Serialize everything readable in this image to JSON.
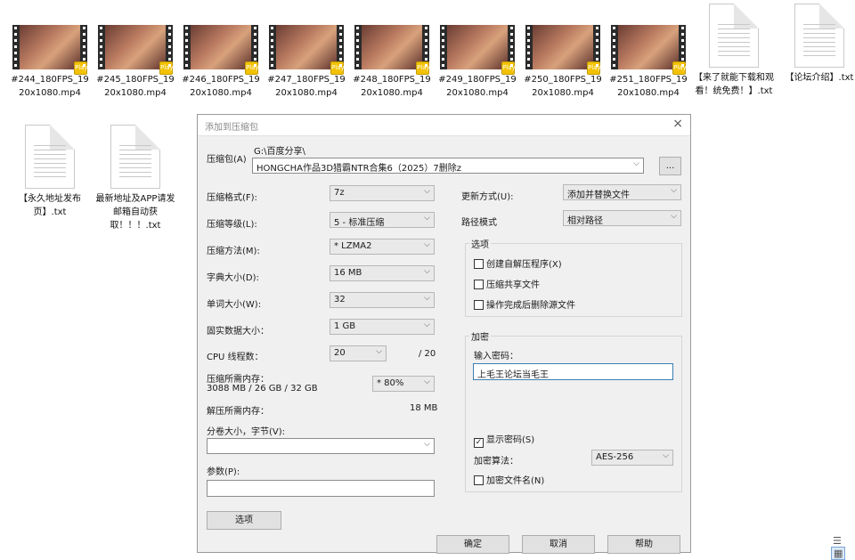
{
  "videos": [
    {
      "name": "#244_180FPS_1920x1080.mp4",
      "badge": "Player"
    },
    {
      "name": "#245_180FPS_1920x1080.mp4",
      "badge": "Player"
    },
    {
      "name": "#246_180FPS_1920x1080.mp4",
      "badge": "Player"
    },
    {
      "name": "#247_180FPS_1920x1080.mp4",
      "badge": "Player"
    },
    {
      "name": "#248_180FPS_1920x1080.mp4",
      "badge": "Player"
    },
    {
      "name": "#249_180FPS_1920x1080.mp4",
      "badge": "Player"
    },
    {
      "name": "#250_180FPS_1920x1080.mp4",
      "badge": "Player"
    },
    {
      "name": "#251_180FPS_1920x1080.mp4",
      "badge": "Player"
    }
  ],
  "docs_top": [
    {
      "name": "【来了就能下载和观看！统免费！】.txt"
    },
    {
      "name": "【论坛介绍】.txt"
    }
  ],
  "docs_left": [
    {
      "name": "【永久地址发布页】.txt"
    },
    {
      "name": "最新地址及APP请发邮箱自动获取！！！.txt"
    }
  ],
  "dialog": {
    "title": "添加到压缩包",
    "close": "×",
    "archive_label": "压缩包(A)",
    "archive_path": "G:\\百度分享\\",
    "archive_name": "HONGCHA作品3D猎霸NTR合集6（2025）7删除z",
    "browse": "...",
    "format_label": "压缩格式(F):",
    "format_value": "7z",
    "level_label": "压缩等级(L):",
    "level_value": "5 - 标准压缩",
    "method_label": "压缩方法(M):",
    "method_value": "* LZMA2",
    "dict_label": "字典大小(D):",
    "dict_value": "16 MB",
    "word_label": "单词大小(W):",
    "word_value": "32",
    "solid_label": "固实数据大小：",
    "solid_value": "1 GB",
    "cpu_label": "CPU 线程数：",
    "cpu_value": "20",
    "cpu_max": "/ 20",
    "mem_label": "压缩所需内存：",
    "mem_detail": "3088 MB / 26 GB / 32 GB",
    "mem_percent": "* 80%",
    "demem_label": "解压所需内存：",
    "demem_value": "18 MB",
    "split_label": "分卷大小，字节(V):",
    "split_value": "",
    "params_label": "参数(P):",
    "params_value": "",
    "options_btn": "选项",
    "update_label": "更新方式(U):",
    "update_value": "添加并替换文件",
    "pathmode_label": "路径模式",
    "pathmode_value": "相对路径",
    "options_group": "选项",
    "opt_sfx": "创建自解压程序(X)",
    "opt_shared": "压缩共享文件",
    "opt_delete": "操作完成后删除源文件",
    "enc_group": "加密",
    "pwd_label": "输入密码：",
    "pwd_value": "上毛王论坛当毛王",
    "show_pwd": "显示密码(S)",
    "enc_method_label": "加密算法：",
    "enc_method_value": "AES-256",
    "enc_names": "加密文件名(N)",
    "ok": "确定",
    "cancel": "取消",
    "help": "帮助"
  }
}
